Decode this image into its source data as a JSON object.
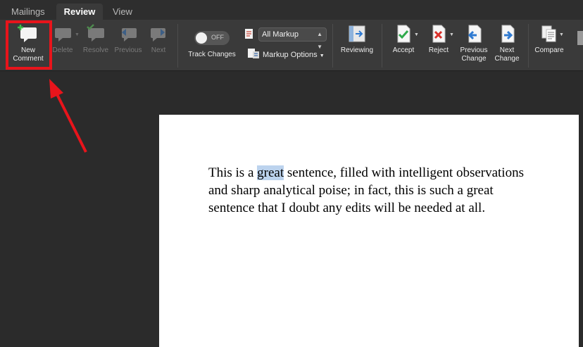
{
  "tabs": [
    {
      "label": "Mailings",
      "active": false
    },
    {
      "label": "Review",
      "active": true
    },
    {
      "label": "View",
      "active": false
    }
  ],
  "ribbon": {
    "new_comment": "New\nComment",
    "delete": "Delete",
    "resolve": "Resolve",
    "previous": "Previous",
    "next": "Next",
    "track_changes": "Track Changes",
    "toggle_state": "OFF",
    "markup_select_value": "All Markup",
    "markup_options": "Markup Options",
    "reviewing": "Reviewing",
    "accept": "Accept",
    "reject": "Reject",
    "previous_change_l1": "Previous",
    "previous_change_l2": "Change",
    "next_change_l1": "Next",
    "next_change_l2": "Change",
    "compare": "Compare"
  },
  "document": {
    "text_before": "This is a ",
    "highlighted": "great",
    "text_after": " sentence, filled with intelligent observations and sharp analytical poise; in fact, this is such a great sentence that I doubt any edits will be needed at all."
  },
  "colors": {
    "annotation_red": "#e8141b",
    "highlight": "#bcd3ee",
    "ribbon_bg": "#3a3a3a"
  }
}
